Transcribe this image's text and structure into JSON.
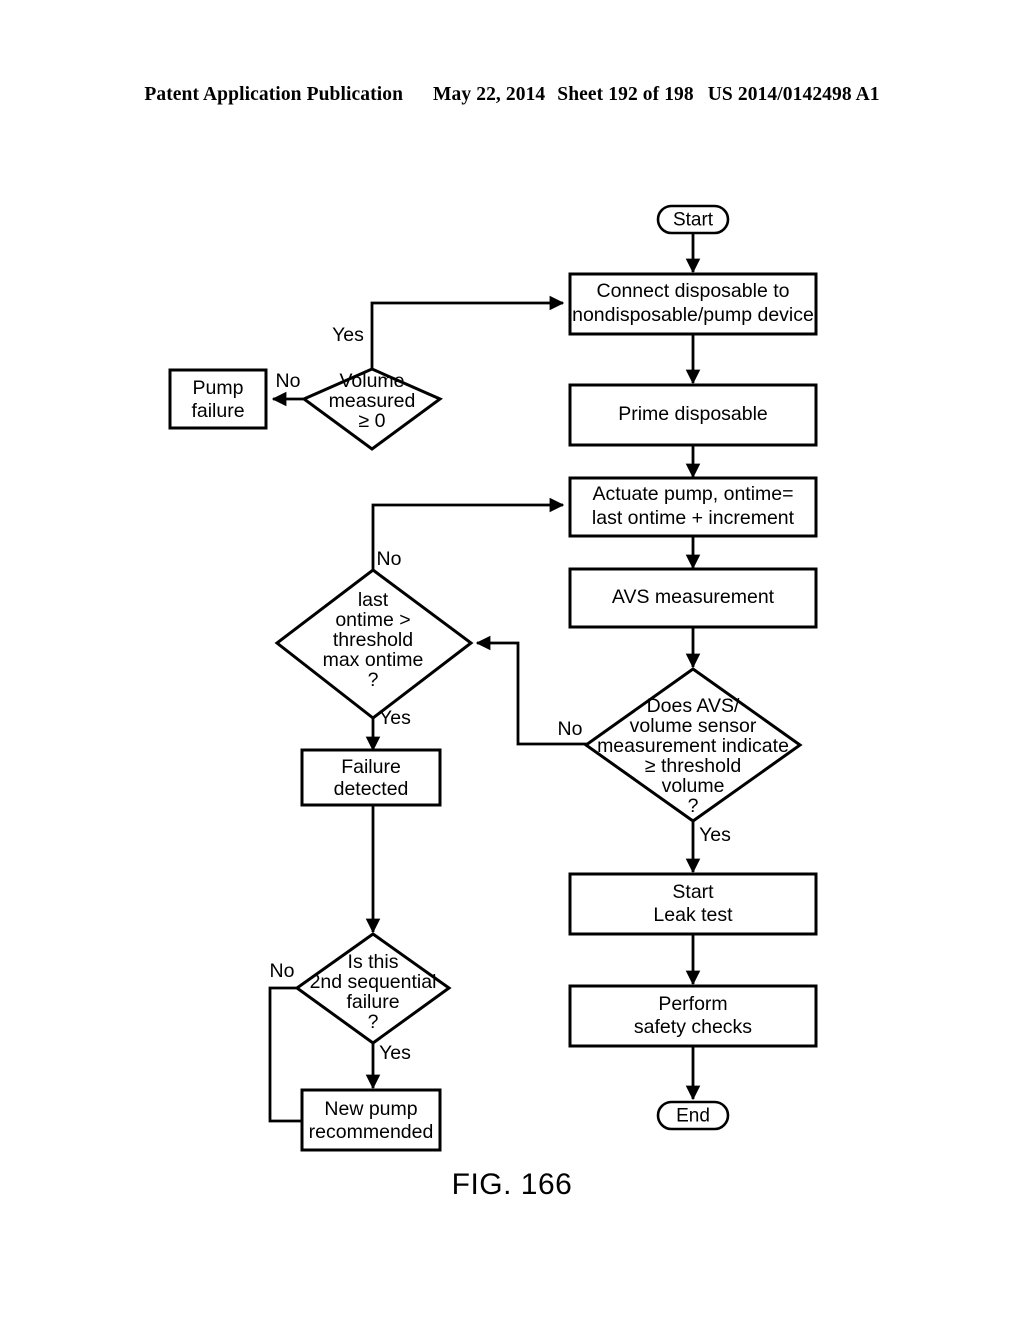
{
  "header": {
    "publication": "Patent Application Publication",
    "date": "May 22, 2014",
    "sheet": "Sheet 192 of 198",
    "patent_number": "US 2014/0142498 A1"
  },
  "figure": {
    "label": "FIG. 166"
  },
  "colors": {
    "stroke": "#000000",
    "fill": "#ffffff",
    "text": "#000000"
  },
  "flowchart": {
    "type": "flowchart",
    "nodes": [
      {
        "id": "start",
        "shape": "terminator",
        "lines": [
          "Start"
        ]
      },
      {
        "id": "connect",
        "shape": "process",
        "lines": [
          "Connect disposable to",
          "nondisposable/pump device"
        ]
      },
      {
        "id": "prime",
        "shape": "process",
        "lines": [
          "Prime disposable"
        ]
      },
      {
        "id": "actuate",
        "shape": "process",
        "lines": [
          "Actuate pump, ontime=",
          "last ontime + increment"
        ]
      },
      {
        "id": "avs",
        "shape": "process",
        "lines": [
          "AVS measurement"
        ]
      },
      {
        "id": "avs_decision",
        "shape": "decision",
        "lines": [
          "Does AVS/",
          "volume sensor",
          "measurement indicate",
          "≥ threshold",
          "volume",
          "?"
        ]
      },
      {
        "id": "leak",
        "shape": "process",
        "lines": [
          "Start",
          "Leak test"
        ]
      },
      {
        "id": "safety",
        "shape": "process",
        "lines": [
          "Perform",
          "safety checks"
        ]
      },
      {
        "id": "end",
        "shape": "terminator",
        "lines": [
          "End"
        ]
      },
      {
        "id": "volume_decision",
        "shape": "decision",
        "lines": [
          "Volume",
          "measured",
          "≥ 0"
        ]
      },
      {
        "id": "pump_failure",
        "shape": "process",
        "lines": [
          "Pump",
          "failure"
        ]
      },
      {
        "id": "ontime_decision",
        "shape": "decision",
        "lines": [
          "last",
          "ontime >",
          "threshold",
          "max ontime",
          "?"
        ]
      },
      {
        "id": "failure_detected",
        "shape": "process",
        "lines": [
          "Failure",
          "detected"
        ]
      },
      {
        "id": "second_decision",
        "shape": "decision",
        "lines": [
          "Is this",
          "2nd sequential",
          "failure",
          "?"
        ]
      },
      {
        "id": "new_pump",
        "shape": "process",
        "lines": [
          "New pump",
          "recommended"
        ]
      }
    ],
    "edges": [
      {
        "from": "start",
        "to": "connect",
        "label": ""
      },
      {
        "from": "connect",
        "to": "prime",
        "label": ""
      },
      {
        "from": "prime",
        "to": "actuate",
        "label": ""
      },
      {
        "from": "actuate",
        "to": "avs",
        "label": ""
      },
      {
        "from": "avs",
        "to": "avs_decision",
        "label": ""
      },
      {
        "from": "avs_decision",
        "to": "leak",
        "label": "Yes"
      },
      {
        "from": "avs_decision",
        "to": "ontime_decision",
        "label": "No"
      },
      {
        "from": "leak",
        "to": "safety",
        "label": ""
      },
      {
        "from": "safety",
        "to": "end",
        "label": ""
      },
      {
        "from": "volume_decision",
        "to": "connect",
        "label": "Yes"
      },
      {
        "from": "volume_decision",
        "to": "pump_failure",
        "label": "No"
      },
      {
        "from": "ontime_decision",
        "to": "actuate",
        "label": "No"
      },
      {
        "from": "ontime_decision",
        "to": "failure_detected",
        "label": "Yes"
      },
      {
        "from": "failure_detected",
        "to": "second_decision",
        "label": ""
      },
      {
        "from": "second_decision",
        "to": "new_pump",
        "label": "Yes"
      },
      {
        "from": "second_decision",
        "to": "new_pump",
        "label": "No"
      }
    ],
    "labels": {
      "start_text": "Start",
      "connect_l1": "Connect disposable to",
      "connect_l2": "nondisposable/pump device",
      "prime_l1": "Prime disposable",
      "actuate_l1": "Actuate pump, ontime=",
      "actuate_l2": "last ontime + increment",
      "avs_l1": "AVS measurement",
      "avsd_l1": "Does AVS/",
      "avsd_l2": "volume sensor",
      "avsd_l3": "measurement indicate",
      "avsd_l4": "≥ threshold",
      "avsd_l5": "volume",
      "avsd_l6": "?",
      "leak_l1": "Start",
      "leak_l2": "Leak test",
      "safety_l1": "Perform",
      "safety_l2": "safety checks",
      "end_text": "End",
      "vol_l1": "Volume",
      "vol_l2": "measured",
      "vol_l3": "≥ 0",
      "pumpfail_l1": "Pump",
      "pumpfail_l2": "failure",
      "ontime_l1": "last",
      "ontime_l2": "ontime >",
      "ontime_l3": "threshold",
      "ontime_l4": "max ontime",
      "ontime_l5": "?",
      "faildet_l1": "Failure",
      "faildet_l2": "detected",
      "second_l1": "Is this",
      "second_l2": "2nd sequential",
      "second_l3": "failure",
      "second_l4": "?",
      "newpump_l1": "New pump",
      "newpump_l2": "recommended",
      "yes_volume": "Yes",
      "no_volume": "No",
      "no_ontime": "No",
      "yes_ontime": "Yes",
      "no_avs": "No",
      "yes_avs": "Yes",
      "no_second": "No",
      "yes_second": "Yes"
    }
  }
}
